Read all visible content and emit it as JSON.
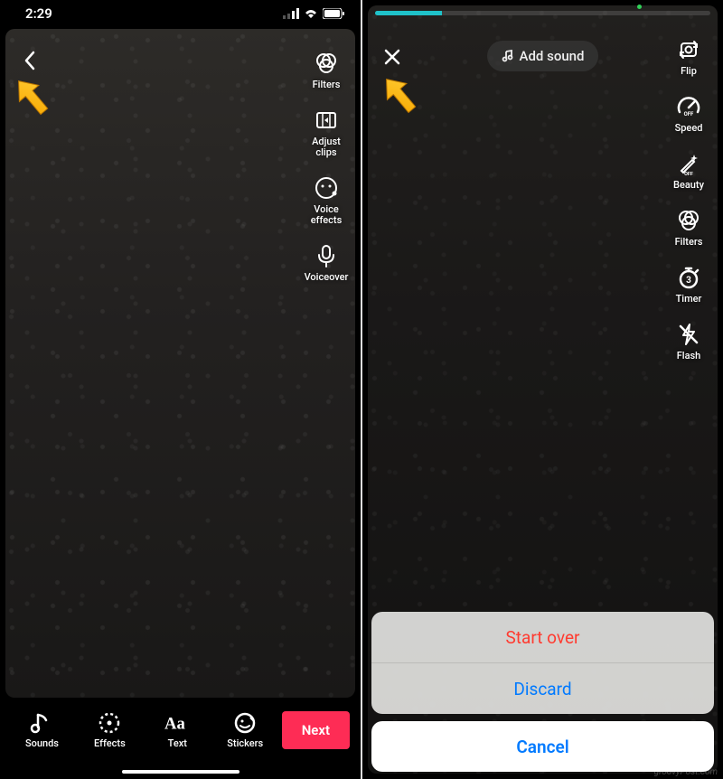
{
  "left": {
    "status": {
      "time": "2:29"
    },
    "tools": {
      "filters": "Filters",
      "adjust_clips": "Adjust clips",
      "voice_effects": "Voice\neffects",
      "voiceover": "Voiceover"
    },
    "bottom": {
      "sounds": "Sounds",
      "effects": "Effects",
      "text": "Text",
      "stickers": "Stickers"
    },
    "next_label": "Next"
  },
  "right": {
    "add_sound": "Add sound",
    "progress_percent": 20,
    "tools": {
      "flip": "Flip",
      "speed": "Speed",
      "beauty": "Beauty",
      "filters": "Filters",
      "timer": "Timer",
      "flash": "Flash"
    },
    "sheet": {
      "start_over": "Start over",
      "discard": "Discard",
      "cancel": "Cancel"
    }
  },
  "watermark": "groovyPost.com"
}
